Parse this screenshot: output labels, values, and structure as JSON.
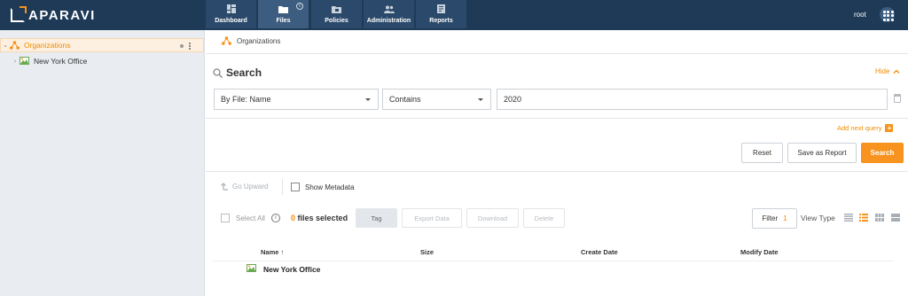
{
  "app": {
    "brand": "APARAVI",
    "user": "root"
  },
  "nav": {
    "tabs": [
      {
        "label": "Dashboard",
        "icon": "dashboard-icon"
      },
      {
        "label": "Files",
        "icon": "folder-icon",
        "active": true
      },
      {
        "label": "Policies",
        "icon": "policies-icon"
      },
      {
        "label": "Administration",
        "icon": "users-icon"
      },
      {
        "label": "Reports",
        "icon": "reports-icon"
      }
    ]
  },
  "sidebar": {
    "root": "Organizations",
    "child": "New York Office"
  },
  "breadcrumb": "Organizations",
  "search": {
    "title": "Search",
    "hide_label": "Hide",
    "field_selector": "By File: Name",
    "operator": "Contains",
    "value": "2020",
    "add_query": "Add next query",
    "reset": "Reset",
    "save_report": "Save as Report",
    "submit": "Search"
  },
  "toolbar": {
    "go_upward": "Go Upward",
    "show_metadata": "Show Metadata",
    "select_all": "Select All",
    "files_selected_count": "0",
    "files_selected_text": "files selected",
    "tag": "Tag",
    "export_data": "Export Data",
    "download": "Download",
    "delete": "Delete",
    "filter": "Filter",
    "filter_count": "1",
    "view_type": "View Type"
  },
  "table": {
    "columns": [
      "Name",
      "Size",
      "Create Date",
      "Modify Date"
    ],
    "rows": [
      {
        "name": "New York Office"
      }
    ]
  },
  "colors": {
    "accent": "#f7931e",
    "topbar": "#1e3a57"
  }
}
